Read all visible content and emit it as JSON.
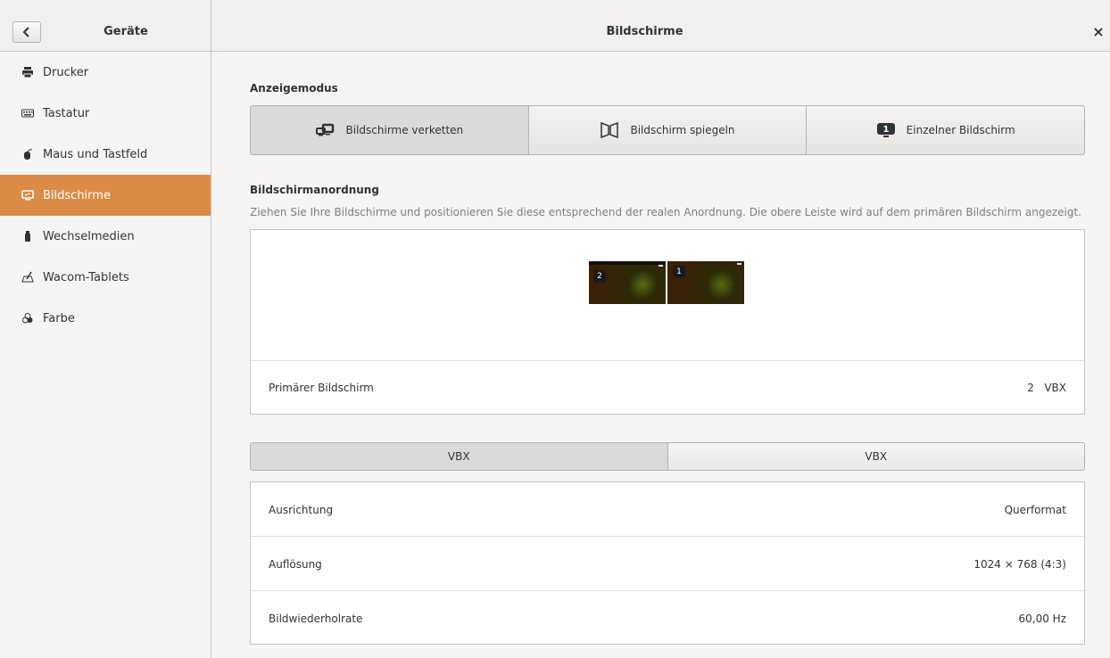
{
  "header": {
    "left_title": "Geräte",
    "main_title": "Bildschirme",
    "close_glyph": "×"
  },
  "sidebar": {
    "items": [
      {
        "label": "Drucker",
        "icon": "printer-icon"
      },
      {
        "label": "Tastatur",
        "icon": "keyboard-icon"
      },
      {
        "label": "Maus und Tastfeld",
        "icon": "mouse-icon"
      },
      {
        "label": "Bildschirme",
        "icon": "display-icon",
        "active": true
      },
      {
        "label": "Wechselmedien",
        "icon": "media-icon"
      },
      {
        "label": "Wacom-Tablets",
        "icon": "tablet-icon"
      },
      {
        "label": "Farbe",
        "icon": "color-icon"
      }
    ]
  },
  "display_mode": {
    "label": "Anzeigemodus",
    "options": [
      {
        "label": "Bildschirme verketten",
        "icon": "join-displays-icon",
        "selected": true
      },
      {
        "label": "Bildschirm spiegeln",
        "icon": "mirror-displays-icon",
        "selected": false
      },
      {
        "label": "Einzelner Bildschirm",
        "icon": "single-display-icon",
        "badge": "1",
        "selected": false
      }
    ]
  },
  "arrangement": {
    "label": "Bildschirmanordnung",
    "description": "Ziehen Sie Ihre Bildschirme und positionieren Sie diese entsprechend der realen Anordnung. Die obere Leiste wird auf dem primären Bildschirm angezeigt.",
    "monitors": [
      {
        "number": "2",
        "primary": true
      },
      {
        "number": "1",
        "primary": false
      }
    ],
    "primary_label": "Primärer Bildschirm",
    "primary_value": "2   VBX"
  },
  "display_tabs": [
    {
      "label": "VBX",
      "selected": true
    },
    {
      "label": "VBX",
      "selected": false
    }
  ],
  "settings": [
    {
      "label": "Ausrichtung",
      "value": "Querformat"
    },
    {
      "label": "Auflösung",
      "value": "1024 × 768 (4:3)"
    },
    {
      "label": "Bildwiederholrate",
      "value": "60,00 Hz"
    }
  ],
  "colors": {
    "accent": "#dc8b47",
    "background": "#f6f5f4",
    "text": "#2e3436"
  }
}
